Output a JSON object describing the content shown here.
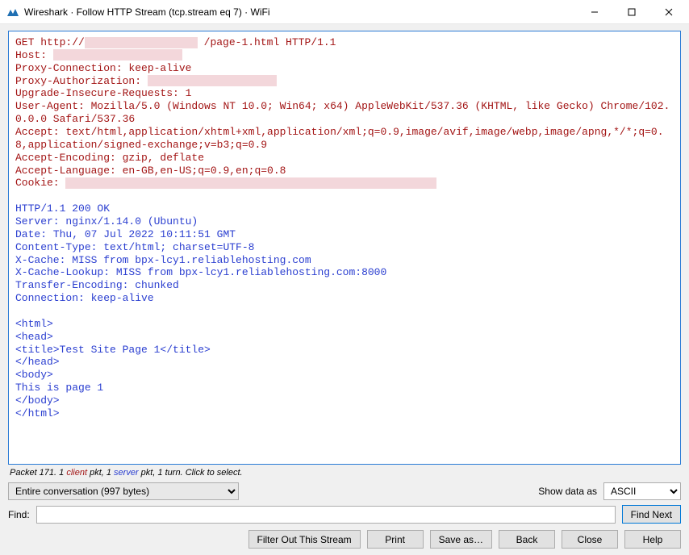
{
  "window": {
    "title": "Wireshark · Follow HTTP Stream (tcp.stream eq 7) · WiFi"
  },
  "stream": {
    "request": {
      "line1_a": "GET http://",
      "line1_b": "/page-1.html HTTP/1.1",
      "host_label": "Host: ",
      "proxy_conn": "Proxy-Connection: keep-alive",
      "proxy_auth_label": "Proxy-Authorization: ",
      "upgrade": "Upgrade-Insecure-Requests: 1",
      "ua": "User-Agent: Mozilla/5.0 (Windows NT 10.0; Win64; x64) AppleWebKit/537.36 (KHTML, like Gecko) Chrome/102.0.0.0 Safari/537.36",
      "accept": "Accept: text/html,application/xhtml+xml,application/xml;q=0.9,image/avif,image/webp,image/apng,*/*;q=0.8,application/signed-exchange;v=b3;q=0.9",
      "accept_enc": "Accept-Encoding: gzip, deflate",
      "accept_lang": "Accept-Language: en-GB,en-US;q=0.9,en;q=0.8",
      "cookie_label": "Cookie: "
    },
    "response": {
      "status": "HTTP/1.1 200 OK",
      "server": "Server: nginx/1.14.0 (Ubuntu)",
      "date": "Date: Thu, 07 Jul 2022 10:11:51 GMT",
      "ctype": "Content-Type: text/html; charset=UTF-8",
      "xcache": "X-Cache: MISS from bpx-lcy1.reliablehosting.com",
      "xcachel": "X-Cache-Lookup: MISS from bpx-lcy1.reliablehosting.com:8000",
      "tenc": "Transfer-Encoding: chunked",
      "conn": "Connection: keep-alive",
      "body1": "<html>",
      "body2": "<head>",
      "body3": "<title>Test Site Page 1</title>",
      "body4": "</head>",
      "body5": "<body>",
      "body6": "This is page 1",
      "body7": "</body>",
      "body8": "</html>"
    }
  },
  "status": {
    "pre": "Packet 171. 1 ",
    "client": "client",
    "mid": " pkt, 1 ",
    "server": "server",
    "post": " pkt, 1 turn. Click to select."
  },
  "controls": {
    "conversation": "Entire conversation (997 bytes)",
    "showas_label": "Show data as",
    "showas_value": "ASCII",
    "find_label": "Find:",
    "find_next": "Find Next"
  },
  "buttons": {
    "filter": "Filter Out This Stream",
    "print": "Print",
    "saveas": "Save as…",
    "back": "Back",
    "close": "Close",
    "help": "Help"
  }
}
